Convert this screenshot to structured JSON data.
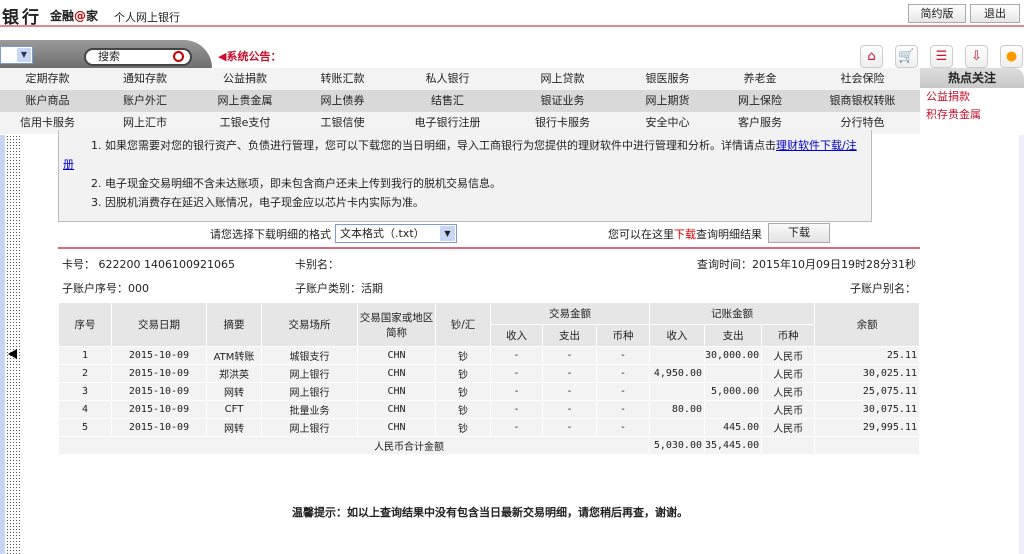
{
  "header": {
    "brand": "银行",
    "brand_sub_a": "金融",
    "brand_sub_at": "@",
    "brand_sub_b": "家",
    "product": "个人网上银行",
    "simple_label": "简约版",
    "logout_label": "退出"
  },
  "toolbar": {
    "search_placeholder": "搜索",
    "notice_label": "◀系统公告：",
    "icons": [
      "home-icon",
      "cart-icon",
      "contacts-icon",
      "download-inbox-icon",
      "headset-icon"
    ]
  },
  "menu": [
    [
      "定期存款",
      "通知存款",
      "公益捐款",
      "转账汇款",
      "私人银行",
      "网上贷款",
      "银医服务",
      "养老金",
      "社会保险"
    ],
    [
      "账户商品",
      "账户外汇",
      "网上贵金属",
      "网上债券",
      "结售汇",
      "银证业务",
      "网上期货",
      "网上保险",
      "银商银权转账"
    ],
    [
      "信用卡服务",
      "网上汇市",
      "工银e支付",
      "工银信使",
      "电子银行注册",
      "银行卡服务",
      "安全中心",
      "客户服务",
      "分行特色"
    ]
  ],
  "hot": {
    "title": "热点关注",
    "links": [
      "公益捐款",
      "积存贵金属"
    ]
  },
  "notes": {
    "n1": "1. 如果您需要对您的银行资产、负债进行管理，您可以下载您的当日明细，导入工商银行为您提供的理财软件中进行管理和分析。详情请点击",
    "n1_link": "理财软件下载/注册",
    "n2": "2. 电子现金交易明细不含未达账项，即未包含商户还未上传到我行的脱机交易信息。",
    "n3": "3. 因脱机消费存在延迟入账情况，电子现金应以芯片卡内实际为准。"
  },
  "download": {
    "format_label": "请您选择下载明细的格式",
    "format_value": "文本格式（.txt）",
    "hint_a": "您可以在这里",
    "hint_red": "下载",
    "hint_b": "查询明细结果",
    "button": "下载"
  },
  "info": {
    "card_no": "卡号： 622200 1406100921065",
    "card_alias": "卡别名：",
    "query_time": "查询时间：2015年10月09日19时28分31秒",
    "sub_no": "子账户序号：000",
    "sub_type": "子账户类别：活期",
    "sub_alias": "子账户别名："
  },
  "table": {
    "h": {
      "seq": "序号",
      "date": "交易日期",
      "summary": "摘要",
      "place": "交易场所",
      "country": "交易国家或地区简称",
      "cash": "钞/汇",
      "trade_amt": "交易金额",
      "book_amt": "记账金额",
      "income": "收入",
      "expense": "支出",
      "currency": "币种",
      "balance": "余额"
    },
    "rows": [
      [
        "1",
        "2015-10-09",
        "ATM转账",
        "城银支行",
        "CHN",
        "钞",
        "-",
        "-",
        "-",
        "",
        "30,000.00",
        "人民币",
        "25.11"
      ],
      [
        "2",
        "2015-10-09",
        "郑洪英",
        "网上银行",
        "CHN",
        "钞",
        "-",
        "-",
        "-",
        "4,950.00",
        "",
        "人民币",
        "30,025.11"
      ],
      [
        "3",
        "2015-10-09",
        "网转",
        "网上银行",
        "CHN",
        "钞",
        "-",
        "-",
        "-",
        "",
        "5,000.00",
        "人民币",
        "25,075.11"
      ],
      [
        "4",
        "2015-10-09",
        "CFT",
        "批量业务",
        "CHN",
        "钞",
        "-",
        "-",
        "-",
        "80.00",
        "",
        "人民币",
        "30,075.11"
      ],
      [
        "5",
        "2015-10-09",
        "网转",
        "网上银行",
        "CHN",
        "钞",
        "-",
        "-",
        "-",
        "",
        "445.00",
        "人民币",
        "29,995.11"
      ]
    ],
    "total_label": "人民币合计金额",
    "total_income": "5,030.00",
    "total_expense": "35,445.00"
  },
  "tip": "温馨提示：如以上查询结果中没有包含当日最新交易明细，请您稍后再查，谢谢。"
}
